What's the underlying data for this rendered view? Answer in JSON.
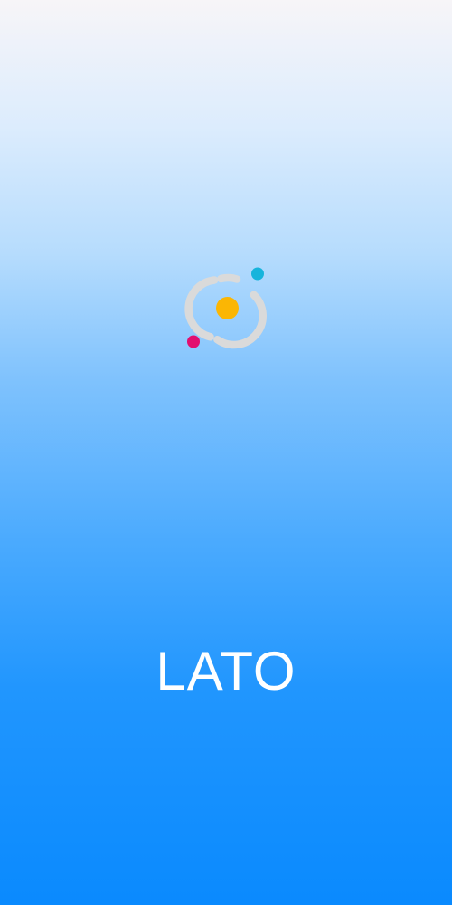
{
  "app": {
    "name": "LATO"
  },
  "logo": {
    "icon": "orbit-logo-icon",
    "colors": {
      "ring": "#dadada",
      "core": "#fbb604",
      "satellite_top": "#16b4dc",
      "satellite_bottom": "#e20f6f"
    }
  },
  "background": {
    "gradient_top": "#f7f5f8",
    "gradient_bottom": "#0a8afe"
  }
}
